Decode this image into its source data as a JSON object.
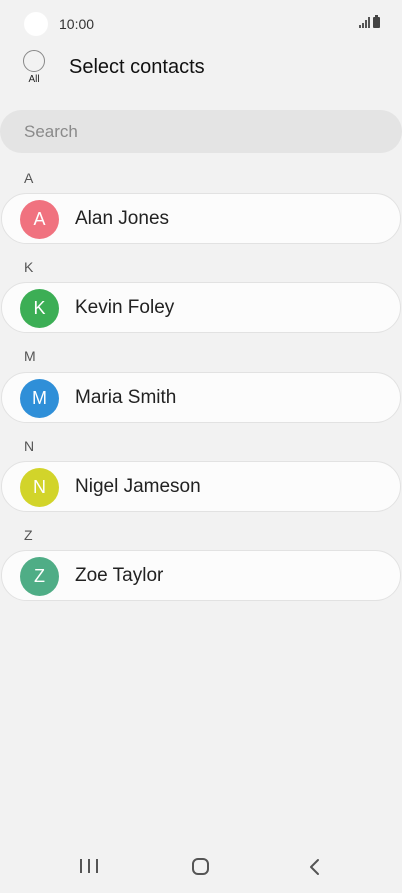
{
  "status_bar": {
    "time": "10:00"
  },
  "header": {
    "all_label": "All",
    "title": "Select contacts"
  },
  "search": {
    "placeholder": "Search"
  },
  "sections": [
    {
      "letter": "A",
      "contacts": [
        {
          "initial": "A",
          "name": "Alan Jones",
          "color": "#f0727f"
        }
      ]
    },
    {
      "letter": "K",
      "contacts": [
        {
          "initial": "K",
          "name": "Kevin Foley",
          "color": "#3cae55"
        }
      ]
    },
    {
      "letter": "M",
      "contacts": [
        {
          "initial": "M",
          "name": "Maria Smith",
          "color": "#2f8fd8"
        }
      ]
    },
    {
      "letter": "N",
      "contacts": [
        {
          "initial": "N",
          "name": "Nigel Jameson",
          "color": "#d2d42a"
        }
      ]
    },
    {
      "letter": "Z",
      "contacts": [
        {
          "initial": "Z",
          "name": "Zoe Taylor",
          "color": "#4fad86"
        }
      ]
    }
  ],
  "icons": {
    "status_left": "circle-indicator-icon",
    "signal": "signal-icon",
    "battery": "battery-icon",
    "recent": "recent-apps-icon",
    "home": "home-icon",
    "back": "back-icon"
  }
}
